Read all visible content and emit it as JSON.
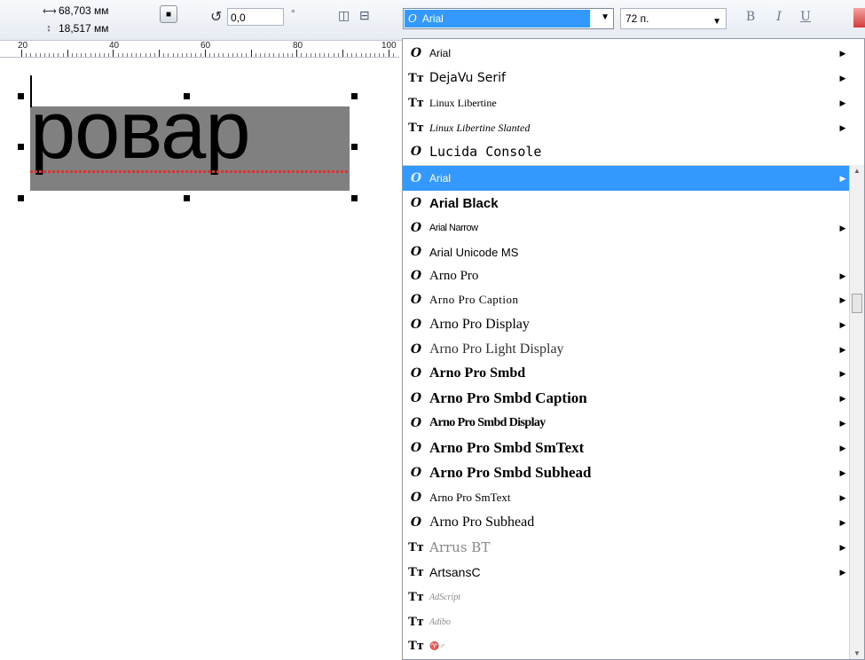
{
  "property_bar": {
    "width_value": "68,703 мм",
    "height_value": "18,517 мм",
    "rotation_value": "0,0",
    "degree_symbol": "°",
    "font_name": "Arial",
    "font_size": "72 п.",
    "bold_label": "B",
    "italic_label": "I",
    "underline_label": "U"
  },
  "ruler": {
    "labels": [
      "20",
      "40",
      "60",
      "80",
      "100"
    ]
  },
  "canvas": {
    "text": "ровар"
  },
  "dropdown": {
    "recent_fonts": [
      {
        "name": "Arial",
        "icon": "opentype-icon",
        "submenu": true
      },
      {
        "name": "DejaVu Serif",
        "icon": "truetype-icon",
        "submenu": true
      },
      {
        "name": "Linux Libertine",
        "icon": "truetype-icon",
        "submenu": true
      },
      {
        "name": "Linux Libertine Slanted",
        "icon": "truetype-icon",
        "submenu": true
      },
      {
        "name": "Lucida Console",
        "icon": "opentype-icon",
        "submenu": false
      }
    ],
    "fonts": [
      {
        "name": "Arial",
        "icon": "opentype-icon",
        "submenu": true,
        "selected": true
      },
      {
        "name": "Arial Black",
        "icon": "opentype-icon",
        "submenu": false
      },
      {
        "name": "Arial Narrow",
        "icon": "opentype-icon",
        "submenu": true
      },
      {
        "name": "Arial Unicode MS",
        "icon": "opentype-icon",
        "submenu": false
      },
      {
        "name": "Arno Pro",
        "icon": "opentype-icon",
        "submenu": true
      },
      {
        "name": "Arno Pro Caption",
        "icon": "opentype-icon",
        "submenu": true
      },
      {
        "name": "Arno Pro Display",
        "icon": "opentype-icon",
        "submenu": true
      },
      {
        "name": "Arno Pro Light Display",
        "icon": "opentype-icon",
        "submenu": true
      },
      {
        "name": "Arno Pro Smbd",
        "icon": "opentype-icon",
        "submenu": true
      },
      {
        "name": "Arno Pro Smbd Caption",
        "icon": "opentype-icon",
        "submenu": true
      },
      {
        "name": "Arno Pro Smbd Display",
        "icon": "opentype-icon",
        "submenu": true
      },
      {
        "name": "Arno Pro Smbd SmText",
        "icon": "opentype-icon",
        "submenu": true
      },
      {
        "name": "Arno Pro Smbd Subhead",
        "icon": "opentype-icon",
        "submenu": true
      },
      {
        "name": "Arno Pro SmText",
        "icon": "opentype-icon",
        "submenu": true
      },
      {
        "name": "Arno Pro Subhead",
        "icon": "opentype-icon",
        "submenu": true
      },
      {
        "name": "Arrus BT",
        "icon": "truetype-icon",
        "submenu": true
      },
      {
        "name": "ArtsansC",
        "icon": "truetype-icon",
        "submenu": true
      },
      {
        "name": "AdScript",
        "icon": "truetype-icon",
        "submenu": false
      },
      {
        "name": "Adibo",
        "icon": "truetype-icon",
        "submenu": false
      },
      {
        "name": "♈♂",
        "icon": "truetype-icon",
        "submenu": false
      }
    ]
  },
  "colors": {
    "selection": "#3399ff",
    "text_box_fill": "#808080",
    "spell_squiggle": "#e03030"
  }
}
